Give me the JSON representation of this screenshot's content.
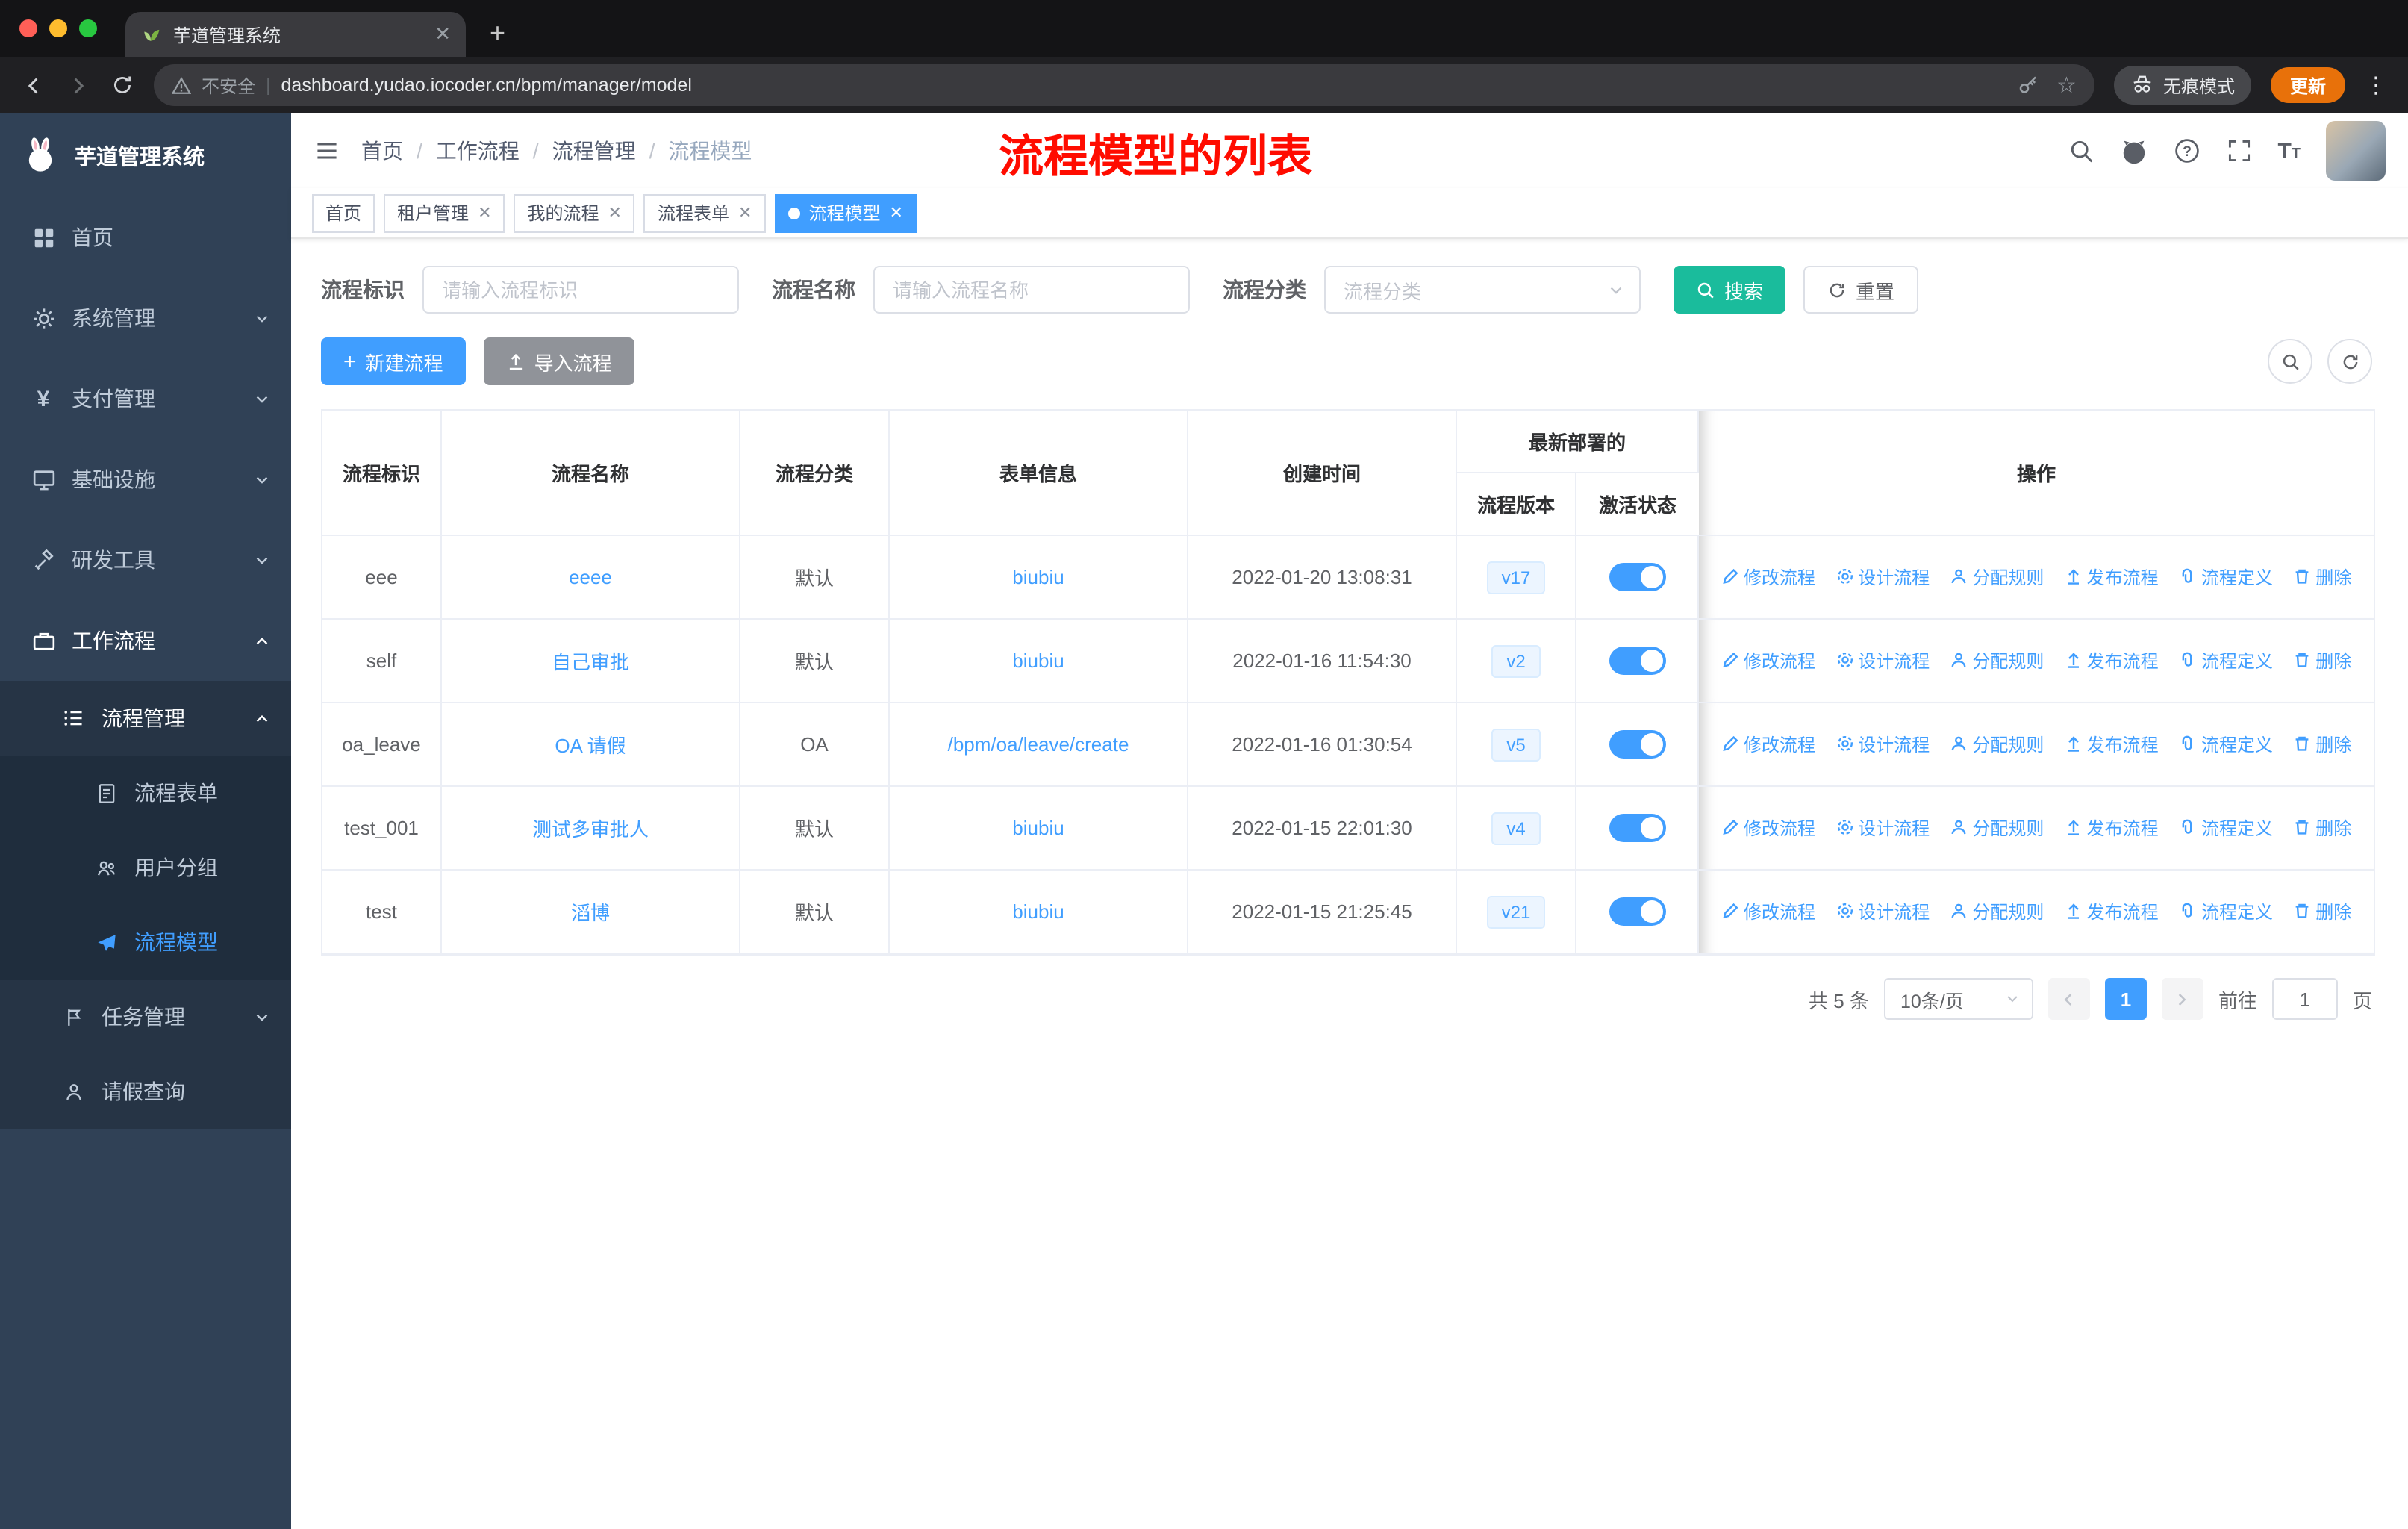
{
  "browser": {
    "tab_title": "芋道管理系统",
    "security_label": "不安全",
    "url": "dashboard.yudao.iocoder.cn/bpm/manager/model",
    "incognito_label": "无痕模式",
    "update_label": "更新"
  },
  "sidebar": {
    "logo_title": "芋道管理系统",
    "top_items": [
      {
        "label": "首页",
        "icon": "dashboard-icon"
      },
      {
        "label": "系统管理",
        "icon": "gear-icon",
        "chevron": "down"
      },
      {
        "label": "支付管理",
        "icon": "yen-icon",
        "chevron": "down"
      },
      {
        "label": "基础设施",
        "icon": "monitor-icon",
        "chevron": "down"
      },
      {
        "label": "研发工具",
        "icon": "tool-icon",
        "chevron": "down"
      },
      {
        "label": "工作流程",
        "icon": "briefcase-icon",
        "chevron": "up"
      }
    ],
    "workflow_children": {
      "process_mgmt_label": "流程管理",
      "process_children": [
        "流程表单",
        "用户分组",
        "流程模型"
      ],
      "active_child": "流程模型",
      "task_mgmt_label": "任务管理",
      "leave_query_label": "请假查询"
    }
  },
  "header": {
    "breadcrumb": [
      "首页",
      "工作流程",
      "流程管理",
      "流程模型"
    ],
    "annotation": "流程模型的列表"
  },
  "tags": [
    {
      "label": "首页",
      "closable": false,
      "active": false
    },
    {
      "label": "租户管理",
      "closable": true,
      "active": false
    },
    {
      "label": "我的流程",
      "closable": true,
      "active": false
    },
    {
      "label": "流程表单",
      "closable": true,
      "active": false
    },
    {
      "label": "流程模型",
      "closable": true,
      "active": true
    }
  ],
  "filters": {
    "key_label": "流程标识",
    "key_placeholder": "请输入流程标识",
    "name_label": "流程名称",
    "name_placeholder": "请输入流程名称",
    "category_label": "流程分类",
    "category_placeholder": "流程分类",
    "search_label": "搜索",
    "reset_label": "重置"
  },
  "toolbar": {
    "create_label": "新建流程",
    "import_label": "导入流程"
  },
  "table": {
    "headers": {
      "key": "流程标识",
      "name": "流程名称",
      "category": "流程分类",
      "form": "表单信息",
      "created": "创建时间",
      "deploy_group": "最新部署的",
      "version": "流程版本",
      "status": "激活状态",
      "actions": "操作"
    },
    "rows": [
      {
        "key": "eee",
        "name": "eeee",
        "category": "默认",
        "form": "biubiu",
        "created": "2022-01-20 13:08:31",
        "version": "v17",
        "active": true
      },
      {
        "key": "self",
        "name": "自己审批",
        "category": "默认",
        "form": "biubiu",
        "created": "2022-01-16 11:54:30",
        "version": "v2",
        "active": true
      },
      {
        "key": "oa_leave",
        "name": "OA 请假",
        "category": "OA",
        "form": "/bpm/oa/leave/create",
        "created": "2022-01-16 01:30:54",
        "version": "v5",
        "active": true
      },
      {
        "key": "test_001",
        "name": "测试多审批人",
        "category": "默认",
        "form": "biubiu",
        "created": "2022-01-15 22:01:30",
        "version": "v4",
        "active": true
      },
      {
        "key": "test",
        "name": "滔博",
        "category": "默认",
        "form": "biubiu",
        "created": "2022-01-15 21:25:45",
        "version": "v21",
        "active": true
      }
    ],
    "row_actions": [
      "修改流程",
      "设计流程",
      "分配规则",
      "发布流程",
      "流程定义",
      "删除"
    ]
  },
  "pagination": {
    "total": "共 5 条",
    "page_size": "10条/页",
    "current_page": "1",
    "goto_label": "前往",
    "goto_value": "1",
    "page_unit": "页"
  },
  "colors": {
    "accent": "#409eff",
    "link": "#409eff",
    "sidebar_bg": "#304156",
    "sidebar_submenu_bg": "#263445",
    "sidebar_submenu_deep_bg": "#1f2d3d",
    "search_button": "#1abc9c",
    "info_button": "#909399",
    "annotation_red": "#ff0c00",
    "update_chip": "#e8710a",
    "version_tag_bg": "#ecf5ff"
  },
  "navbar_icons": [
    "search-icon",
    "github-icon",
    "help-icon",
    "fullscreen-icon",
    "font-size-icon"
  ]
}
